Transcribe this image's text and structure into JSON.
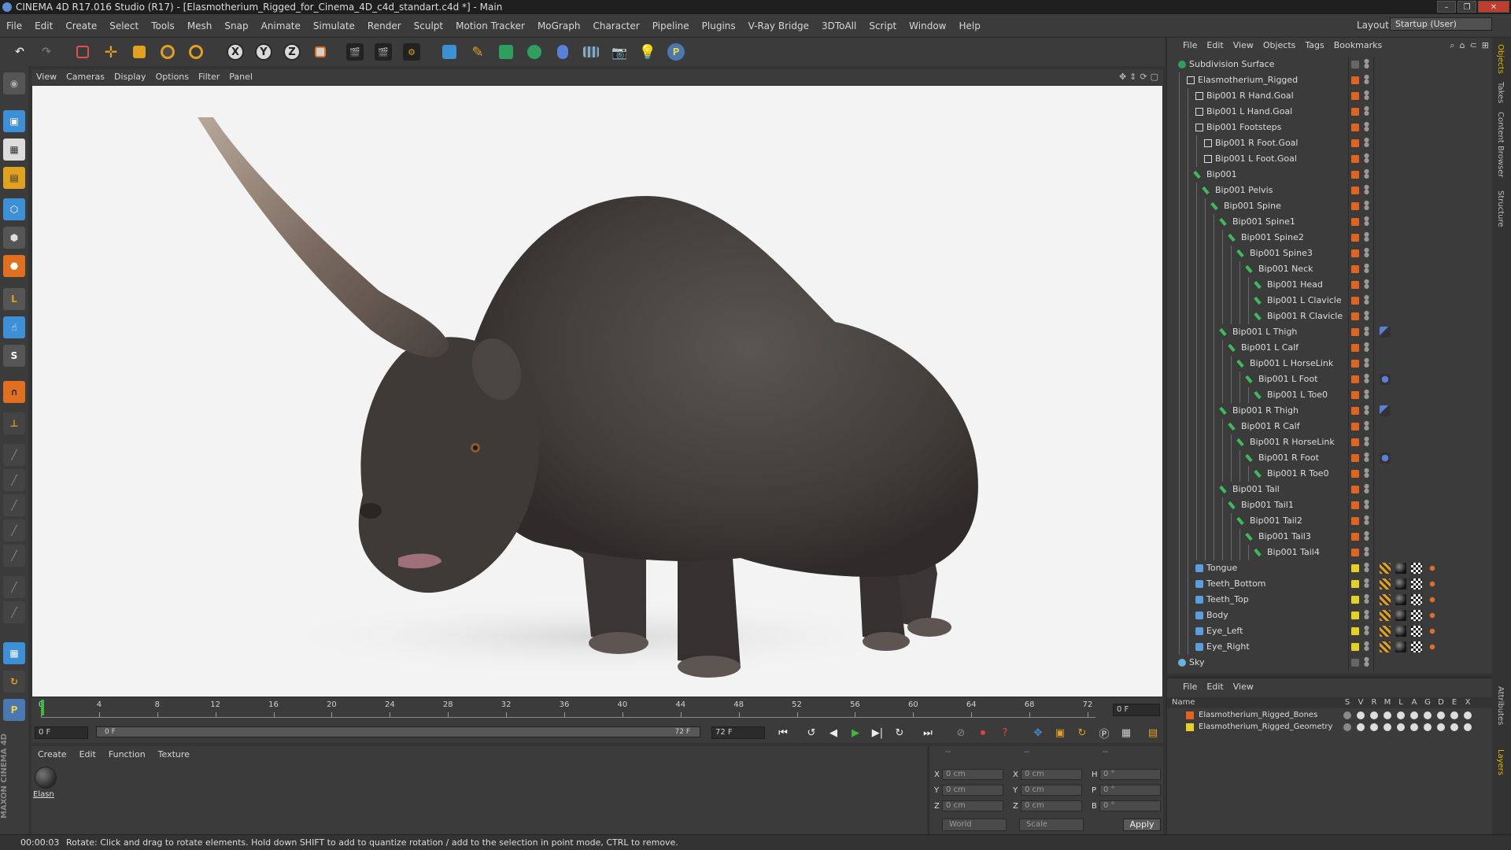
{
  "window": {
    "title": "CINEMA 4D R17.016 Studio (R17) - [Elasmotherium_Rigged_for_Cinema_4D_c4d_standart.c4d *] - Main",
    "buttons": [
      "–",
      "❐",
      "✕"
    ]
  },
  "menubar": {
    "items": [
      "File",
      "Edit",
      "Create",
      "Select",
      "Tools",
      "Mesh",
      "Snap",
      "Animate",
      "Simulate",
      "Render",
      "Sculpt",
      "Motion Tracker",
      "MoGraph",
      "Character",
      "Pipeline",
      "Plugins",
      "V-Ray Bridge",
      "3DToAll",
      "Script",
      "Window",
      "Help"
    ],
    "layout_label": "Layout:",
    "layout_value": "Startup (User)"
  },
  "toolbar": {
    "axis": [
      "X",
      "Y",
      "Z"
    ]
  },
  "viewport": {
    "menu": [
      "View",
      "Cameras",
      "Display",
      "Options",
      "Filter",
      "Panel"
    ]
  },
  "timeline": {
    "ticks": [
      "0",
      "4",
      "8",
      "12",
      "16",
      "20",
      "24",
      "28",
      "32",
      "36",
      "40",
      "44",
      "48",
      "52",
      "56",
      "60",
      "64",
      "68",
      "72"
    ],
    "current_frame": "0 F",
    "range_start": "0 F",
    "range_bar_start": "0 F",
    "range_bar_end": "72 F",
    "range_end": "72 F"
  },
  "material": {
    "menu": [
      "Create",
      "Edit",
      "Function",
      "Texture"
    ],
    "name": "Elasn"
  },
  "coords": {
    "header": [
      "--",
      "--",
      "--"
    ],
    "rows": [
      {
        "a": "X",
        "av": "0 cm",
        "b": "X",
        "bv": "0 cm",
        "c": "H",
        "cv": "0 °"
      },
      {
        "a": "Y",
        "av": "0 cm",
        "b": "Y",
        "bv": "0 cm",
        "c": "P",
        "cv": "0 °"
      },
      {
        "a": "Z",
        "av": "0 cm",
        "b": "Z",
        "bv": "0 cm",
        "c": "B",
        "cv": "0 °"
      }
    ],
    "world": "World",
    "scale": "Scale",
    "apply": "Apply"
  },
  "status": {
    "time": "00:00:03",
    "message": "Rotate: Click and drag to rotate elements. Hold down SHIFT to add to quantize rotation / add to the selection in point mode, CTRL to remove."
  },
  "objects": {
    "menu": [
      "File",
      "Edit",
      "View",
      "Objects",
      "Tags",
      "Bookmarks"
    ],
    "tree": [
      {
        "name": "Subdivision Surface",
        "depth": 0,
        "type": "subdiv",
        "layer": "none"
      },
      {
        "name": "Elasmotherium_Rigged",
        "depth": 1,
        "type": "null",
        "layer": "orange"
      },
      {
        "name": "Bip001 R Hand.Goal",
        "depth": 2,
        "type": "null",
        "layer": "orange"
      },
      {
        "name": "Bip001 L Hand.Goal",
        "depth": 2,
        "type": "null",
        "layer": "orange"
      },
      {
        "name": "Bip001 Footsteps",
        "depth": 2,
        "type": "null",
        "layer": "orange"
      },
      {
        "name": "Bip001 R Foot.Goal",
        "depth": 3,
        "type": "null",
        "layer": "orange"
      },
      {
        "name": "Bip001 L Foot.Goal",
        "depth": 3,
        "type": "null",
        "layer": "orange"
      },
      {
        "name": "Bip001",
        "depth": 2,
        "type": "bone",
        "layer": "orange"
      },
      {
        "name": "Bip001 Pelvis",
        "depth": 3,
        "type": "bone",
        "layer": "orange"
      },
      {
        "name": "Bip001 Spine",
        "depth": 4,
        "type": "bone",
        "layer": "orange"
      },
      {
        "name": "Bip001 Spine1",
        "depth": 5,
        "type": "bone",
        "layer": "orange"
      },
      {
        "name": "Bip001 Spine2",
        "depth": 6,
        "type": "bone",
        "layer": "orange"
      },
      {
        "name": "Bip001 Spine3",
        "depth": 7,
        "type": "bone",
        "layer": "orange"
      },
      {
        "name": "Bip001 Neck",
        "depth": 8,
        "type": "bone",
        "layer": "orange"
      },
      {
        "name": "Bip001 Head",
        "depth": 9,
        "type": "bone",
        "layer": "orange"
      },
      {
        "name": "Bip001 L Clavicle",
        "depth": 9,
        "type": "bone",
        "layer": "orange"
      },
      {
        "name": "Bip001 R Clavicle",
        "depth": 9,
        "type": "bone",
        "layer": "orange"
      },
      {
        "name": "Bip001 L Thigh",
        "depth": 5,
        "type": "bone",
        "layer": "orange",
        "tag": "ik"
      },
      {
        "name": "Bip001 L Calf",
        "depth": 6,
        "type": "bone",
        "layer": "orange"
      },
      {
        "name": "Bip001 L HorseLink",
        "depth": 7,
        "type": "bone",
        "layer": "orange"
      },
      {
        "name": "Bip001 L Foot",
        "depth": 8,
        "type": "bone",
        "layer": "orange",
        "tag": "ik2"
      },
      {
        "name": "Bip001 L Toe0",
        "depth": 9,
        "type": "bone",
        "layer": "orange"
      },
      {
        "name": "Bip001 R Thigh",
        "depth": 5,
        "type": "bone",
        "layer": "orange",
        "tag": "ik"
      },
      {
        "name": "Bip001 R Calf",
        "depth": 6,
        "type": "bone",
        "layer": "orange"
      },
      {
        "name": "Bip001 R HorseLink",
        "depth": 7,
        "type": "bone",
        "layer": "orange"
      },
      {
        "name": "Bip001 R Foot",
        "depth": 8,
        "type": "bone",
        "layer": "orange",
        "tag": "ik2"
      },
      {
        "name": "Bip001 R Toe0",
        "depth": 9,
        "type": "bone",
        "layer": "orange"
      },
      {
        "name": "Bip001 Tail",
        "depth": 5,
        "type": "bone",
        "layer": "orange"
      },
      {
        "name": "Bip001 Tail1",
        "depth": 6,
        "type": "bone",
        "layer": "orange"
      },
      {
        "name": "Bip001 Tail2",
        "depth": 7,
        "type": "bone",
        "layer": "orange"
      },
      {
        "name": "Bip001 Tail3",
        "depth": 8,
        "type": "bone",
        "layer": "orange"
      },
      {
        "name": "Bip001 Tail4",
        "depth": 9,
        "type": "bone",
        "layer": "orange"
      },
      {
        "name": "Tongue",
        "depth": 2,
        "type": "mesh",
        "layer": "yellow",
        "tag": "mesh"
      },
      {
        "name": "Teeth_Bottom",
        "depth": 2,
        "type": "mesh",
        "layer": "yellow",
        "tag": "mesh"
      },
      {
        "name": "Teeth_Top",
        "depth": 2,
        "type": "mesh",
        "layer": "yellow",
        "tag": "mesh"
      },
      {
        "name": "Body",
        "depth": 2,
        "type": "mesh",
        "layer": "yellow",
        "tag": "mesh"
      },
      {
        "name": "Eye_Left",
        "depth": 2,
        "type": "mesh",
        "layer": "yellow",
        "tag": "mesh"
      },
      {
        "name": "Eye_Right",
        "depth": 2,
        "type": "mesh",
        "layer": "yellow",
        "tag": "mesh"
      },
      {
        "name": "Sky",
        "depth": 0,
        "type": "sky",
        "layer": "none"
      }
    ]
  },
  "layers": {
    "menu": [
      "File",
      "Edit",
      "View"
    ],
    "header_name": "Name",
    "columns": [
      "S",
      "V",
      "R",
      "M",
      "L",
      "A",
      "G",
      "D",
      "E",
      "X"
    ],
    "rows": [
      {
        "name": "Elasmotherium_Rigged_Bones",
        "color": "#e0641e"
      },
      {
        "name": "Elasmotherium_Rigged_Geometry",
        "color": "#e6d21e"
      }
    ]
  },
  "right_tabs": [
    "Objects",
    "Takes",
    "Content Browser",
    "Structure",
    "Attributes",
    "Layers"
  ],
  "brand": "MAXON CINEMA 4D",
  "colors": {
    "orange": "#e0641e",
    "yellow": "#e6d21e",
    "accent": "#e6b200",
    "playhead": "#3dbb3d"
  }
}
